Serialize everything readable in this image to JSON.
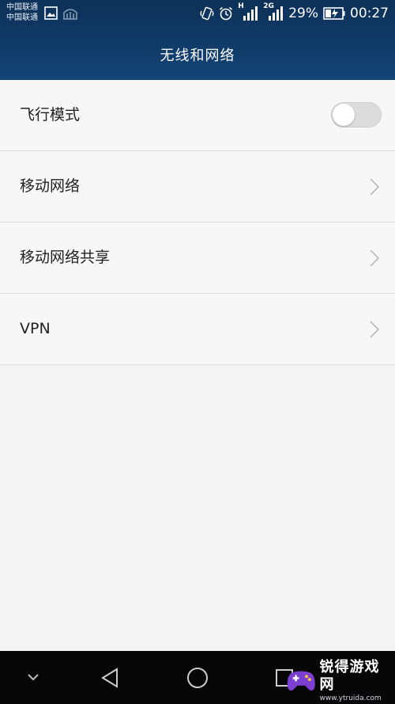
{
  "status_bar": {
    "carrier_1": "中国联通",
    "carrier_2": "中国联通",
    "signal_1_type": "H",
    "signal_2_type": "2G",
    "battery": "29%",
    "time": "00:27"
  },
  "header": {
    "title": "无线和网络"
  },
  "settings": {
    "items": [
      {
        "label": "飞行模式",
        "control": "toggle",
        "on": false
      },
      {
        "label": "移动网络",
        "control": "chevron"
      },
      {
        "label": "移动网络共享",
        "control": "chevron"
      },
      {
        "label": "VPN",
        "control": "chevron"
      }
    ]
  },
  "navbar": {
    "buttons": [
      "chevron-down-icon",
      "back-icon",
      "home-icon",
      "recents-icon"
    ]
  },
  "watermark": {
    "title": "锐得游戏网",
    "url": "www.ytruida.com"
  },
  "colors": {
    "header": "#103a66",
    "background": "#f4f4f4",
    "navbar": "#070707",
    "watermark_accent": "#7b3fd1"
  }
}
